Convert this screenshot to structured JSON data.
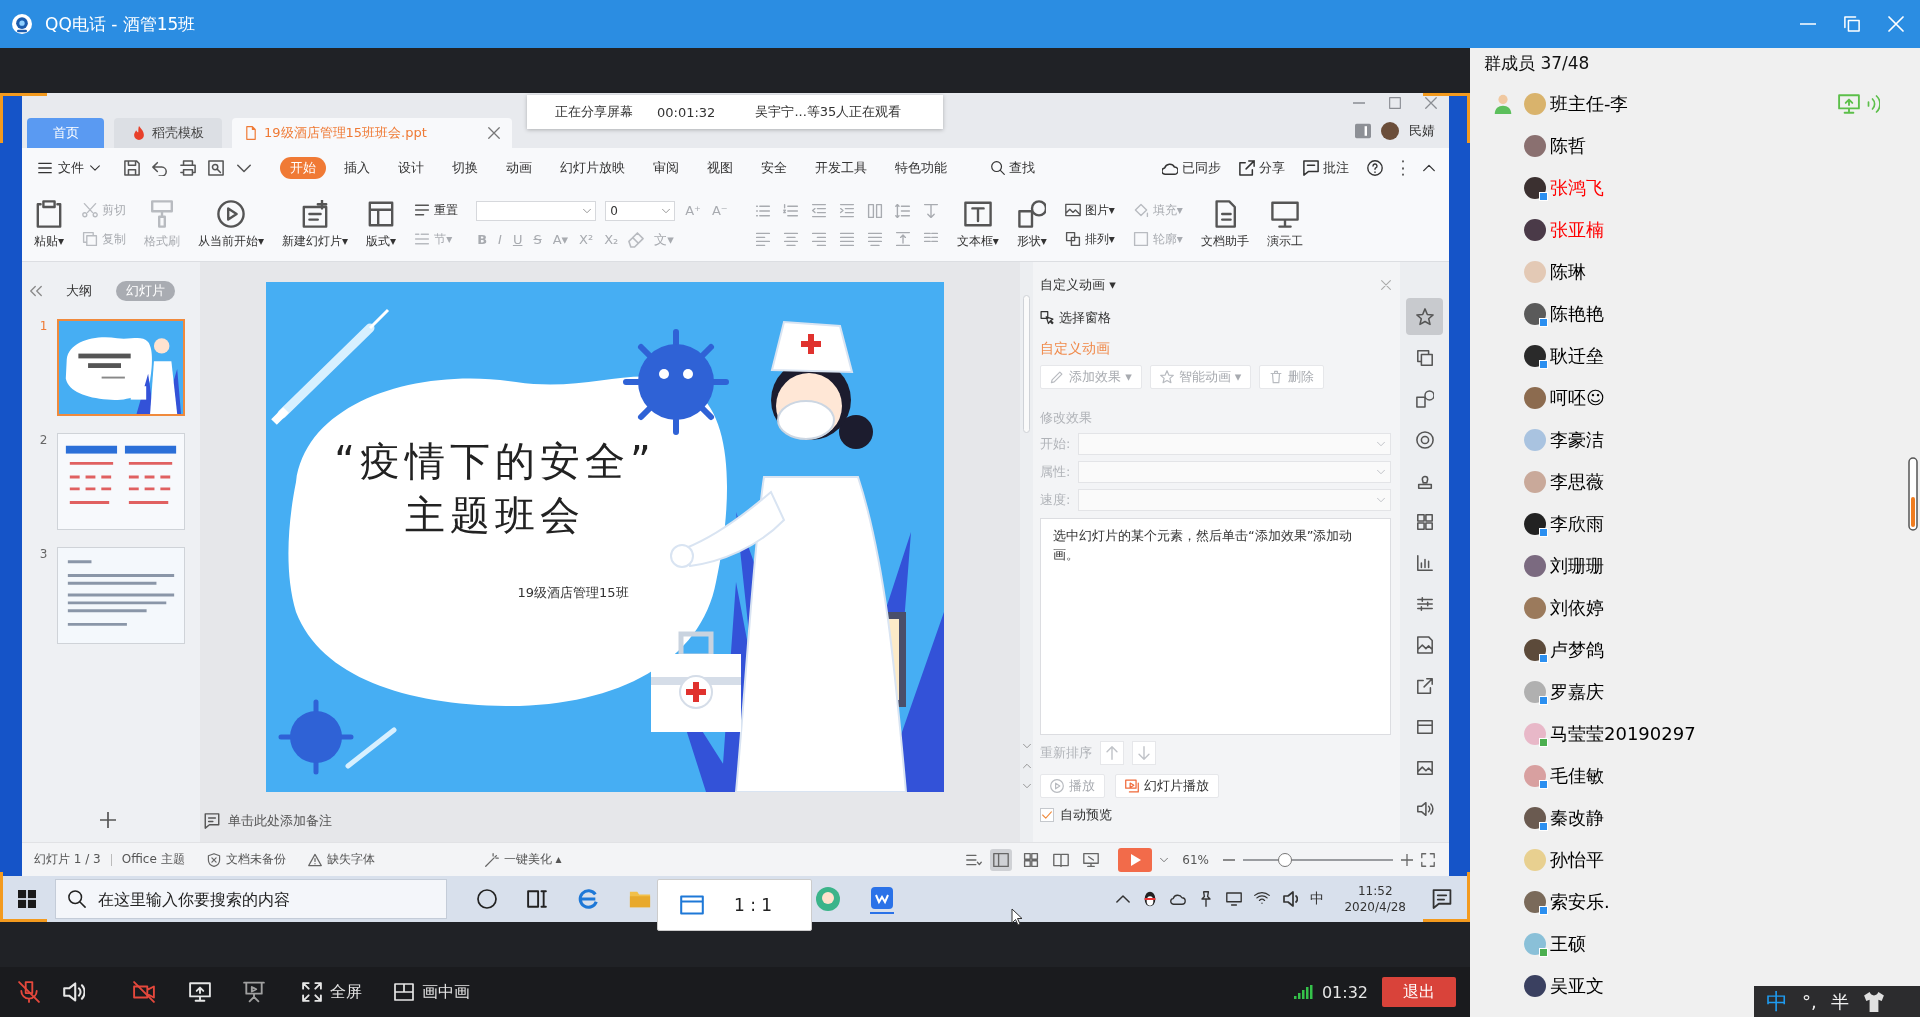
{
  "window": {
    "title": "QQ电话 - 酒管15班"
  },
  "shared_screen": {
    "banner": {
      "status": "正在分享屏幕",
      "timer": "00:01:32",
      "viewers": "吴宇宁...等35人正在观看"
    },
    "app": {
      "tabs": [
        {
          "label": "首页",
          "kind": "home",
          "selected": false
        },
        {
          "label": "稻壳模板",
          "kind": "store",
          "selected": false
        },
        {
          "label": "19级酒店管理15班班会.ppt",
          "kind": "file",
          "selected": true
        }
      ],
      "account": {
        "name": "民婧"
      },
      "file_menu": "文件",
      "menu": [
        {
          "label": "开始",
          "selected": true
        },
        {
          "label": "插入",
          "selected": false
        },
        {
          "label": "设计",
          "selected": false
        },
        {
          "label": "切换",
          "selected": false
        },
        {
          "label": "动画",
          "selected": false
        },
        {
          "label": "幻灯片放映",
          "selected": false
        },
        {
          "label": "审阅",
          "selected": false
        },
        {
          "label": "视图",
          "selected": false
        },
        {
          "label": "安全",
          "selected": false
        },
        {
          "label": "开发工具",
          "selected": false
        },
        {
          "label": "特色功能",
          "selected": false
        }
      ],
      "search": "查找",
      "menu_right": [
        "已同步",
        "分享",
        "批注"
      ],
      "ribbon": [
        [
          {
            "kind": "large",
            "label": "粘贴▾",
            "disabled": false
          }
        ],
        [
          {
            "kind": "small",
            "label": "剪切",
            "disabled": true
          },
          {
            "kind": "small",
            "label": "复制",
            "disabled": true
          }
        ],
        [
          {
            "kind": "large",
            "label": "格式刷",
            "disabled": true
          }
        ],
        [
          {
            "kind": "large",
            "label": "从当前开始▾",
            "disabled": false
          }
        ],
        [
          {
            "kind": "large",
            "label": "新建幻灯片▾",
            "disabled": false
          }
        ],
        [
          {
            "kind": "large",
            "label": "版式▾",
            "disabled": false
          }
        ],
        [
          {
            "kind": "small",
            "label": "重置",
            "disabled": false
          },
          {
            "kind": "small",
            "label": "节▾",
            "disabled": true
          }
        ]
      ],
      "font": {
        "size": "0",
        "resize": [
          "A⁺",
          "A⁻"
        ],
        "styles": [
          "B",
          "I",
          "U",
          "S",
          "A▾",
          "X²",
          "X₂",
          "文▾"
        ]
      },
      "ribbon_right": [
        [
          {
            "kind": "large",
            "label": "文本框▾",
            "disabled": false
          }
        ],
        [
          {
            "kind": "large",
            "label": "形状▾",
            "disabled": false
          }
        ],
        [
          {
            "kind": "small",
            "label": "图片▾",
            "disabled": false
          },
          {
            "kind": "small",
            "label": "排列▾",
            "disabled": false
          }
        ],
        [
          {
            "kind": "small",
            "label": "填充▾",
            "disabled": true
          },
          {
            "kind": "small",
            "label": "轮廓▾",
            "disabled": true
          }
        ],
        [
          {
            "kind": "large",
            "label": "文档助手",
            "disabled": false
          }
        ],
        [
          {
            "kind": "large",
            "label": "演示工",
            "disabled": false
          }
        ]
      ],
      "view_tabs": [
        {
          "label": "大纲",
          "selected": false
        },
        {
          "label": "幻灯片",
          "selected": true
        }
      ],
      "thumbnails": [
        {
          "number": "1",
          "selected": true
        },
        {
          "number": "2",
          "selected": false
        },
        {
          "number": "3",
          "selected": false
        }
      ],
      "slide": {
        "title": "“疫情下的安全”",
        "subtitle": "主题班会",
        "caption": "19级酒店管理15班"
      },
      "notes_prompt": "单击此处添加备注",
      "animation_pane": {
        "title": "自定义动画 ▾",
        "select_pane": "选择窗格",
        "section": "自定义动画",
        "actions": [
          {
            "label": "添加效果 ▾",
            "disabled": true
          },
          {
            "label": "智能动画 ▾",
            "disabled": true
          },
          {
            "label": "删除",
            "disabled": true
          }
        ],
        "modify": "修改效果",
        "fields": [
          {
            "label": "开始:",
            "disabled": true
          },
          {
            "label": "属性:",
            "disabled": true
          },
          {
            "label": "速度:",
            "disabled": true
          }
        ],
        "hint": "选中幻灯片的某个元素，然后单击“添加效果”添加动画。",
        "reorder": "重新排序",
        "play": {
          "label": "播放",
          "disabled": true
        },
        "slideshow": {
          "label": "幻灯片播放",
          "disabled": false
        },
        "autopreview": {
          "label": "自动预览",
          "checked": true
        }
      },
      "tool_strip": [
        {
          "selected": true
        },
        {
          "selected": false
        },
        {
          "selected": false
        },
        {
          "selected": false
        },
        {
          "selected": false
        },
        {
          "selected": false
        },
        {
          "selected": false
        },
        {
          "selected": false
        },
        {
          "selected": false
        },
        {
          "selected": false
        },
        {
          "selected": false
        },
        {
          "selected": false
        },
        {
          "selected": false
        }
      ],
      "status_bar": {
        "slide_info": "幻灯片 1 / 3",
        "theme": "Office 主题",
        "backup": "文档未备份",
        "fonts": "缺失字体",
        "beautify": "一键美化 ▴",
        "views": [
          {
            "selected": true
          },
          {
            "selected": false
          },
          {
            "selected": false
          },
          {
            "selected": false
          }
        ],
        "zoom": "61%",
        "zoom_slider": {
          "level": 0.28
        }
      }
    },
    "taskbar": {
      "search": {
        "placeholder": "在这里输入你要搜索的内容"
      },
      "ime": "中",
      "time": "11:52",
      "date": "2020/4/28"
    },
    "ratio_popup": {
      "label": "1 : 1"
    }
  },
  "call_toolbar": {
    "mic_muted": true,
    "speaker_muted": false,
    "camera_off": true,
    "fullscreen": "全屏",
    "picture_in_picture": "画中画",
    "duration": "01:32",
    "leave": "退出"
  },
  "members": {
    "title": "群成员 37/48",
    "list": [
      {
        "name": "班主任-李",
        "color": "#000000",
        "host": true,
        "sharing": true,
        "speaking": true
      },
      {
        "name": "陈哲",
        "color": "#000000",
        "host": false,
        "sharing": false,
        "speaking": false
      },
      {
        "name": "张鸿飞",
        "color": "#ff0000",
        "host": false,
        "sharing": false,
        "speaking": false,
        "badge": {
          "color": "#2b8ff0"
        }
      },
      {
        "name": "张亚楠",
        "color": "#ff0000",
        "host": false,
        "sharing": false,
        "speaking": false
      },
      {
        "name": "陈琳",
        "color": "#000000",
        "host": false,
        "sharing": false,
        "speaking": false
      },
      {
        "name": "陈艳艳",
        "color": "#000000",
        "host": false,
        "sharing": false,
        "speaking": false,
        "badge": {
          "color": "#2b8ff0"
        }
      },
      {
        "name": "耿迁垒",
        "color": "#000000",
        "host": false,
        "sharing": false,
        "speaking": false,
        "badge": {
          "color": "#2b8ff0"
        }
      },
      {
        "name": "呵呸☺",
        "color": "#000000",
        "host": false,
        "sharing": false,
        "speaking": false
      },
      {
        "name": "李豪洁",
        "color": "#000000",
        "host": false,
        "sharing": false,
        "speaking": false
      },
      {
        "name": "李思薇",
        "color": "#000000",
        "host": false,
        "sharing": false,
        "speaking": false
      },
      {
        "name": "李欣雨",
        "color": "#000000",
        "host": false,
        "sharing": false,
        "speaking": false,
        "badge": {
          "color": "#2b8ff0"
        }
      },
      {
        "name": "刘珊珊",
        "color": "#000000",
        "host": false,
        "sharing": false,
        "speaking": false
      },
      {
        "name": "刘依婷",
        "color": "#000000",
        "host": false,
        "sharing": false,
        "speaking": false
      },
      {
        "name": "卢梦鸽",
        "color": "#000000",
        "host": false,
        "sharing": false,
        "speaking": false,
        "badge": {
          "color": "#2b8ff0"
        }
      },
      {
        "name": "罗嘉庆",
        "color": "#000000",
        "host": false,
        "sharing": false,
        "speaking": false,
        "badge": {
          "color": "#2b8ff0"
        }
      },
      {
        "name": "马莹莹20190297",
        "color": "#000000",
        "host": false,
        "sharing": false,
        "speaking": false,
        "badge": {
          "color": "#4caf50"
        }
      },
      {
        "name": "毛佳敏",
        "color": "#000000",
        "host": false,
        "sharing": false,
        "speaking": false,
        "badge": {
          "color": "#2b8ff0"
        }
      },
      {
        "name": "秦改静",
        "color": "#000000",
        "host": false,
        "sharing": false,
        "speaking": false,
        "badge": {
          "color": "#2b8ff0"
        }
      },
      {
        "name": "孙怡平",
        "color": "#000000",
        "host": false,
        "sharing": false,
        "speaking": false
      },
      {
        "name": "索安乐.",
        "color": "#000000",
        "host": false,
        "sharing": false,
        "speaking": false,
        "badge": {
          "color": "#2b8ff0"
        }
      },
      {
        "name": "王硕",
        "color": "#000000",
        "host": false,
        "sharing": false,
        "speaking": false,
        "badge": {
          "color": "#4caf50"
        }
      },
      {
        "name": "吴亚文",
        "color": "#000000",
        "host": false,
        "sharing": false,
        "speaking": false
      }
    ]
  },
  "ime_bar": {
    "mode": "中",
    "punctuation": "°,",
    "width": "半"
  }
}
